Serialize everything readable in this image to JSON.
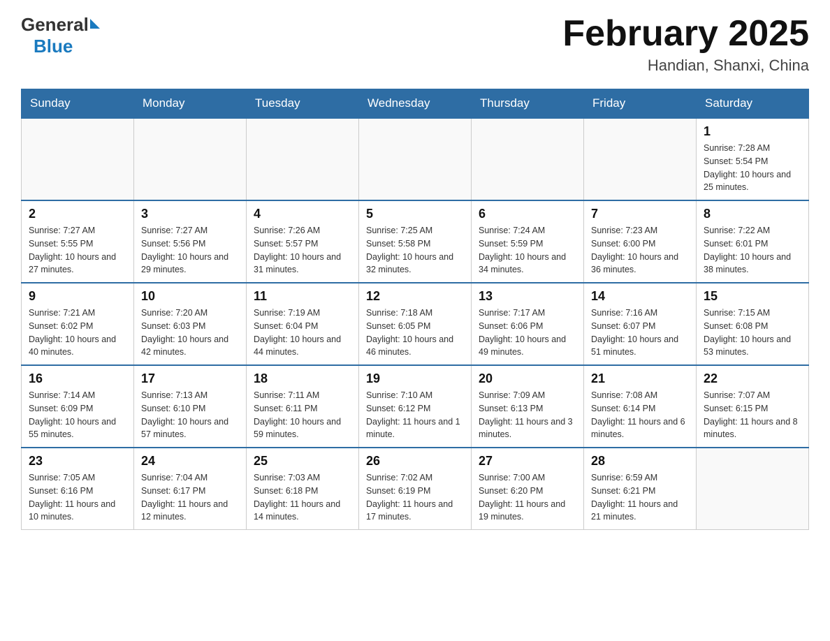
{
  "header": {
    "logo_general": "General",
    "logo_blue": "Blue",
    "month_title": "February 2025",
    "location": "Handian, Shanxi, China"
  },
  "weekdays": [
    "Sunday",
    "Monday",
    "Tuesday",
    "Wednesday",
    "Thursday",
    "Friday",
    "Saturday"
  ],
  "weeks": [
    [
      {
        "day": "",
        "info": ""
      },
      {
        "day": "",
        "info": ""
      },
      {
        "day": "",
        "info": ""
      },
      {
        "day": "",
        "info": ""
      },
      {
        "day": "",
        "info": ""
      },
      {
        "day": "",
        "info": ""
      },
      {
        "day": "1",
        "info": "Sunrise: 7:28 AM\nSunset: 5:54 PM\nDaylight: 10 hours and 25 minutes."
      }
    ],
    [
      {
        "day": "2",
        "info": "Sunrise: 7:27 AM\nSunset: 5:55 PM\nDaylight: 10 hours and 27 minutes."
      },
      {
        "day": "3",
        "info": "Sunrise: 7:27 AM\nSunset: 5:56 PM\nDaylight: 10 hours and 29 minutes."
      },
      {
        "day": "4",
        "info": "Sunrise: 7:26 AM\nSunset: 5:57 PM\nDaylight: 10 hours and 31 minutes."
      },
      {
        "day": "5",
        "info": "Sunrise: 7:25 AM\nSunset: 5:58 PM\nDaylight: 10 hours and 32 minutes."
      },
      {
        "day": "6",
        "info": "Sunrise: 7:24 AM\nSunset: 5:59 PM\nDaylight: 10 hours and 34 minutes."
      },
      {
        "day": "7",
        "info": "Sunrise: 7:23 AM\nSunset: 6:00 PM\nDaylight: 10 hours and 36 minutes."
      },
      {
        "day": "8",
        "info": "Sunrise: 7:22 AM\nSunset: 6:01 PM\nDaylight: 10 hours and 38 minutes."
      }
    ],
    [
      {
        "day": "9",
        "info": "Sunrise: 7:21 AM\nSunset: 6:02 PM\nDaylight: 10 hours and 40 minutes."
      },
      {
        "day": "10",
        "info": "Sunrise: 7:20 AM\nSunset: 6:03 PM\nDaylight: 10 hours and 42 minutes."
      },
      {
        "day": "11",
        "info": "Sunrise: 7:19 AM\nSunset: 6:04 PM\nDaylight: 10 hours and 44 minutes."
      },
      {
        "day": "12",
        "info": "Sunrise: 7:18 AM\nSunset: 6:05 PM\nDaylight: 10 hours and 46 minutes."
      },
      {
        "day": "13",
        "info": "Sunrise: 7:17 AM\nSunset: 6:06 PM\nDaylight: 10 hours and 49 minutes."
      },
      {
        "day": "14",
        "info": "Sunrise: 7:16 AM\nSunset: 6:07 PM\nDaylight: 10 hours and 51 minutes."
      },
      {
        "day": "15",
        "info": "Sunrise: 7:15 AM\nSunset: 6:08 PM\nDaylight: 10 hours and 53 minutes."
      }
    ],
    [
      {
        "day": "16",
        "info": "Sunrise: 7:14 AM\nSunset: 6:09 PM\nDaylight: 10 hours and 55 minutes."
      },
      {
        "day": "17",
        "info": "Sunrise: 7:13 AM\nSunset: 6:10 PM\nDaylight: 10 hours and 57 minutes."
      },
      {
        "day": "18",
        "info": "Sunrise: 7:11 AM\nSunset: 6:11 PM\nDaylight: 10 hours and 59 minutes."
      },
      {
        "day": "19",
        "info": "Sunrise: 7:10 AM\nSunset: 6:12 PM\nDaylight: 11 hours and 1 minute."
      },
      {
        "day": "20",
        "info": "Sunrise: 7:09 AM\nSunset: 6:13 PM\nDaylight: 11 hours and 3 minutes."
      },
      {
        "day": "21",
        "info": "Sunrise: 7:08 AM\nSunset: 6:14 PM\nDaylight: 11 hours and 6 minutes."
      },
      {
        "day": "22",
        "info": "Sunrise: 7:07 AM\nSunset: 6:15 PM\nDaylight: 11 hours and 8 minutes."
      }
    ],
    [
      {
        "day": "23",
        "info": "Sunrise: 7:05 AM\nSunset: 6:16 PM\nDaylight: 11 hours and 10 minutes."
      },
      {
        "day": "24",
        "info": "Sunrise: 7:04 AM\nSunset: 6:17 PM\nDaylight: 11 hours and 12 minutes."
      },
      {
        "day": "25",
        "info": "Sunrise: 7:03 AM\nSunset: 6:18 PM\nDaylight: 11 hours and 14 minutes."
      },
      {
        "day": "26",
        "info": "Sunrise: 7:02 AM\nSunset: 6:19 PM\nDaylight: 11 hours and 17 minutes."
      },
      {
        "day": "27",
        "info": "Sunrise: 7:00 AM\nSunset: 6:20 PM\nDaylight: 11 hours and 19 minutes."
      },
      {
        "day": "28",
        "info": "Sunrise: 6:59 AM\nSunset: 6:21 PM\nDaylight: 11 hours and 21 minutes."
      },
      {
        "day": "",
        "info": ""
      }
    ]
  ]
}
